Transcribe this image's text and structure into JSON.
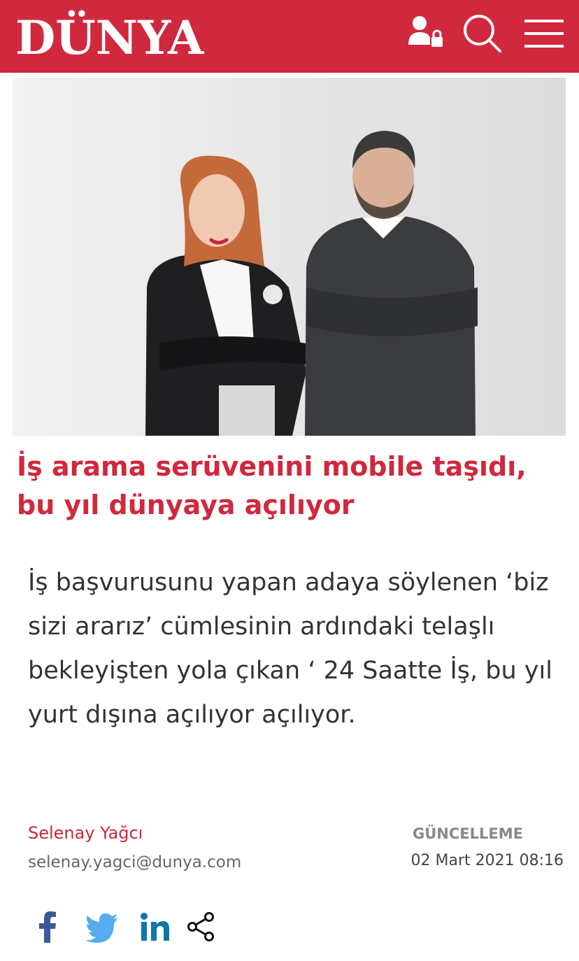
{
  "header": {
    "logo": "DÜNYA",
    "icons": [
      "user-lock-icon",
      "search-icon",
      "menu-icon"
    ],
    "brand_color": "#d0283c"
  },
  "article": {
    "headline": "İş arama serüvenini mobile taşıdı, bu yıl dünyaya açılıyor",
    "summary": "İş başvurusunu yapan adaya söylenen ‘biz sizi ararız’ cümlesinin ardındaki telaşlı bekleyişten yola çıkan ‘ 24 Saatte İş, bu yıl yurt dışına açılıyor açılıyor.",
    "author_name": "Selenay Yağcı",
    "author_email": "selenay.yagci@dunya.com",
    "update_label": "GÜNCELLEME",
    "update_date": "02 Mart 2021 08:16"
  },
  "share": {
    "icons": [
      "facebook-icon",
      "twitter-icon",
      "linkedin-icon",
      "share-icon"
    ],
    "facebook_color": "#3b5998",
    "twitter_color": "#55acee",
    "linkedin_color": "#0e76a8"
  }
}
